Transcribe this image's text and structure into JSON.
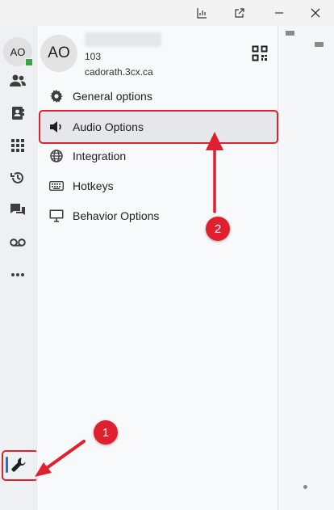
{
  "titlebar": {
    "buttons": [
      {
        "name": "chart-icon"
      },
      {
        "name": "popout-icon"
      },
      {
        "name": "minimize-icon"
      },
      {
        "name": "close-icon"
      }
    ]
  },
  "sidebar": {
    "avatar_initials": "AO",
    "presence_color": "#3aa64a",
    "icons": [
      "contacts-icon",
      "address-book-icon",
      "dialpad-icon",
      "history-icon",
      "chat-icon",
      "voicemail-icon",
      "more-icon"
    ],
    "settings_icon": "wrench-icon"
  },
  "profile": {
    "initials": "AO",
    "extension": "103",
    "domain": "cadorath.3cx.ca"
  },
  "menu": {
    "items": [
      {
        "label": "General options",
        "icon": "gear-icon"
      },
      {
        "label": "Audio Options",
        "icon": "speaker-icon",
        "selected": true
      },
      {
        "label": "Integration",
        "icon": "globe-icon"
      },
      {
        "label": "Hotkeys",
        "icon": "keyboard-icon"
      },
      {
        "label": "Behavior Options",
        "icon": "monitor-icon"
      }
    ]
  },
  "annotations": {
    "callout_1": "1",
    "callout_2": "2",
    "color": "#e0202e"
  }
}
